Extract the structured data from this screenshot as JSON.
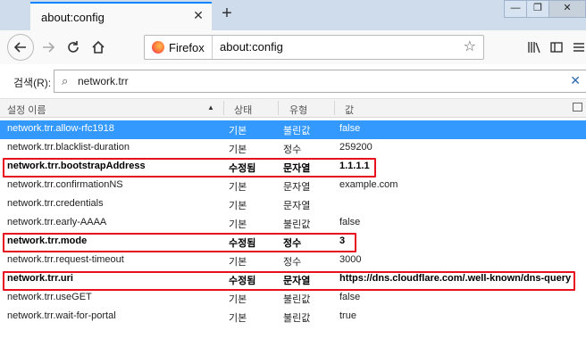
{
  "tab": {
    "title": "about:config",
    "close_glyph": "✕",
    "new_tab_glyph": "+"
  },
  "window_controls": {
    "minimize": "—",
    "maximize": "❐",
    "close": "✕"
  },
  "urlbar": {
    "identity_label": "Firefox",
    "url": "about:config"
  },
  "search": {
    "label": "검색(R):",
    "value": "network.trr"
  },
  "columns": {
    "name": "설정 이름",
    "status": "상태",
    "type": "유형",
    "value": "값"
  },
  "rows": [
    {
      "name": "network.trr.allow-rfc1918",
      "status": "기본",
      "type": "불린값",
      "value": "false"
    },
    {
      "name": "network.trr.blacklist-duration",
      "status": "기본",
      "type": "정수",
      "value": "259200"
    },
    {
      "name": "network.trr.bootstrapAddress",
      "status": "수정됨",
      "type": "문자열",
      "value": "1.1.1.1"
    },
    {
      "name": "network.trr.confirmationNS",
      "status": "기본",
      "type": "문자열",
      "value": "example.com"
    },
    {
      "name": "network.trr.credentials",
      "status": "기본",
      "type": "문자열",
      "value": ""
    },
    {
      "name": "network.trr.early-AAAA",
      "status": "기본",
      "type": "불린값",
      "value": "false"
    },
    {
      "name": "network.trr.mode",
      "status": "수정됨",
      "type": "정수",
      "value": "3"
    },
    {
      "name": "network.trr.request-timeout",
      "status": "기본",
      "type": "정수",
      "value": "3000"
    },
    {
      "name": "network.trr.uri",
      "status": "수정됨",
      "type": "문자열",
      "value": "https://dns.cloudflare.com/.well-known/dns-query"
    },
    {
      "name": "network.trr.useGET",
      "status": "기본",
      "type": "불린값",
      "value": "false"
    },
    {
      "name": "network.trr.wait-for-portal",
      "status": "기본",
      "type": "불린값",
      "value": "true"
    }
  ],
  "colors": {
    "selection": "#3399ff",
    "highlight_box": "#e8101e",
    "tab_accent": "#0a84ff"
  }
}
